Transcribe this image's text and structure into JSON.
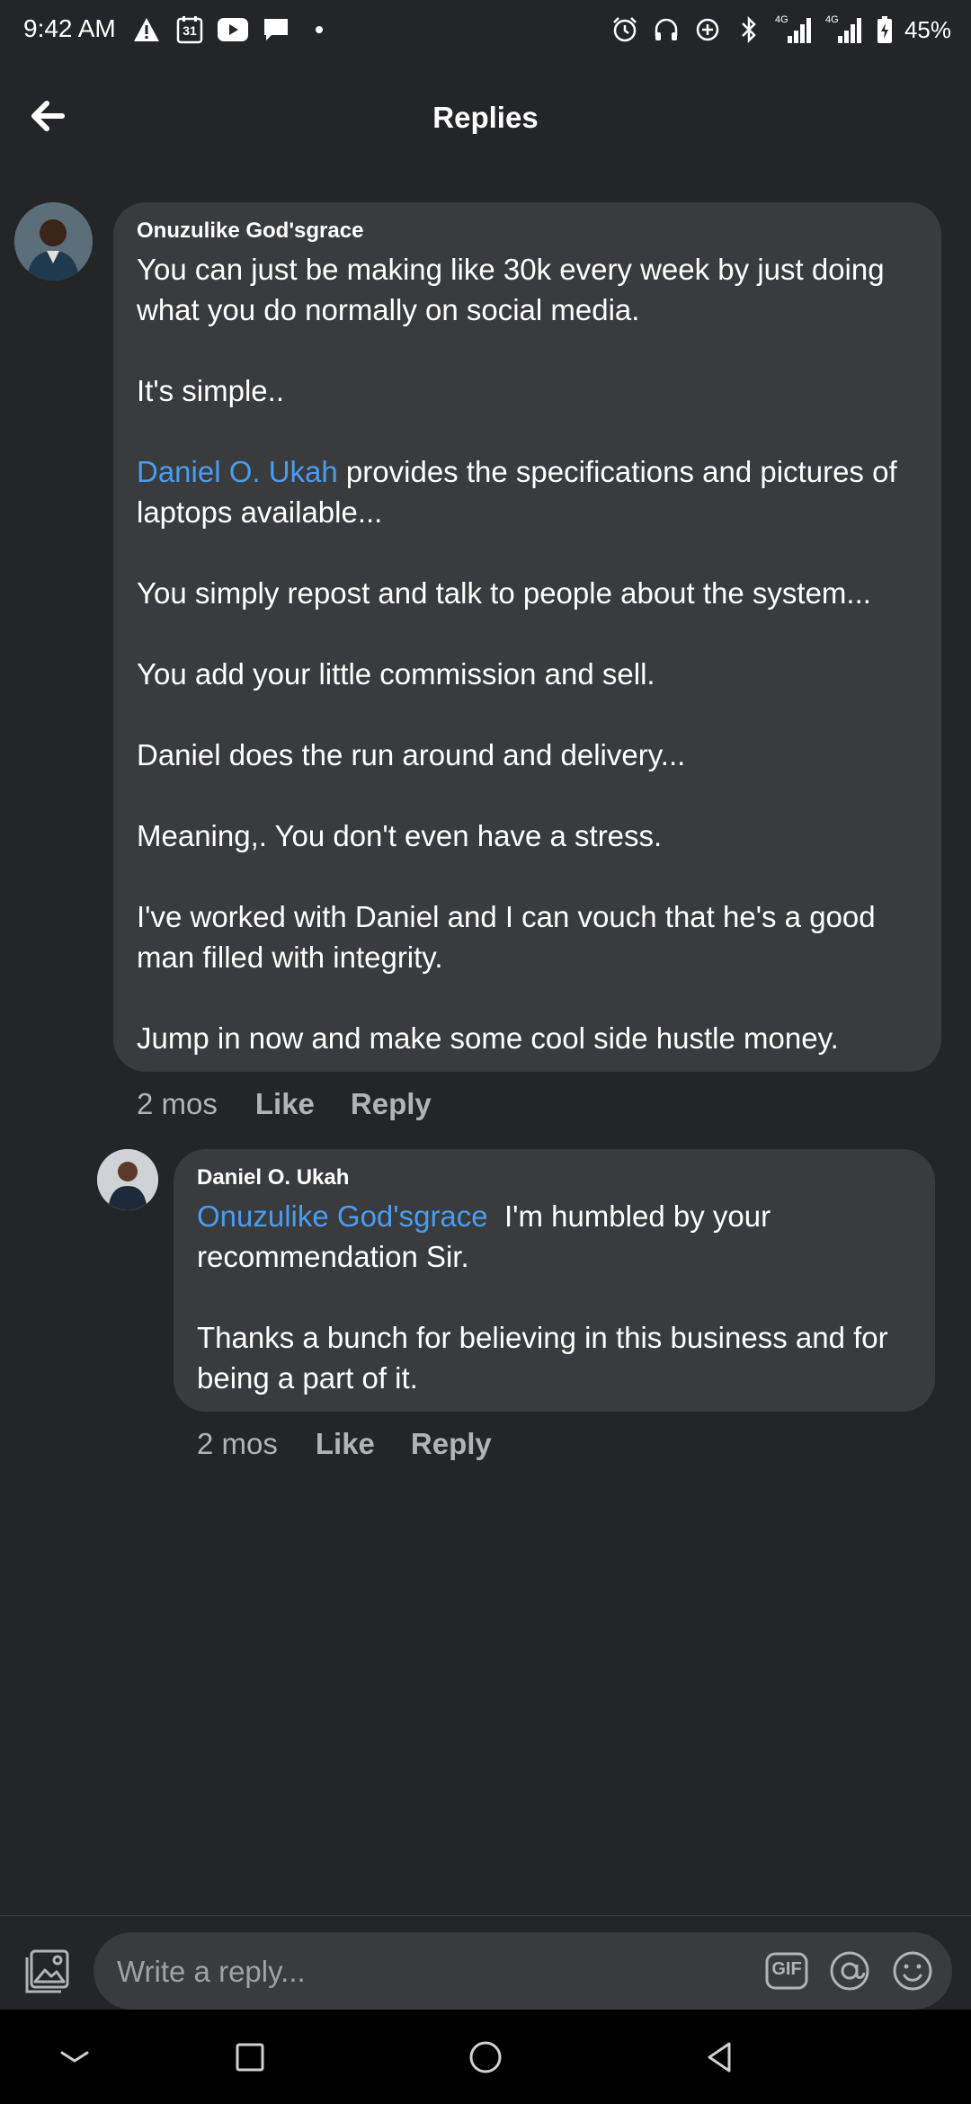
{
  "status_bar": {
    "time": "9:42 AM",
    "calendar_day": "31",
    "network_labels": [
      "4G",
      "4G"
    ],
    "battery": "45%",
    "left_icons": [
      "warning-icon",
      "calendar-icon",
      "youtube-icon",
      "message-icon",
      "dot-icon"
    ],
    "right_icons": [
      "alarm-icon",
      "headphones-icon",
      "data-saver-icon",
      "bluetooth-icon",
      "signal-icon",
      "signal-icon",
      "battery-icon"
    ]
  },
  "header": {
    "title": "Replies",
    "back_icon": "arrow-left-icon"
  },
  "comments": [
    {
      "author": "Onuzulike God'sgrace",
      "paragraphs": [
        {
          "text": "You can just be making like 30k every week by just doing what you do normally on social media."
        },
        {
          "text": "It's simple.."
        },
        {
          "mention": "Daniel O. Ukah",
          "text": " provides the specifications and pictures of laptops available..."
        },
        {
          "text": "You simply repost and talk to people about the system..."
        },
        {
          "text": "You add your little commission and sell."
        },
        {
          "text": "Daniel does the run around and delivery..."
        },
        {
          "text": "Meaning,. You don't even have a stress."
        },
        {
          "text": "I've worked with Daniel and I can vouch that he's a good man filled with integrity."
        },
        {
          "text": "Jump in now and make some cool side hustle money."
        }
      ],
      "time": "2 mos",
      "like_label": "Like",
      "reply_label": "Reply"
    },
    {
      "author": "Daniel O. Ukah",
      "paragraphs": [
        {
          "mention": "Onuzulike God'sgrace",
          "text": "  I'm humbled by your recommendation Sir."
        },
        {
          "text": "Thanks a bunch for believing in this business and for being a part of it."
        }
      ],
      "time": "2 mos",
      "like_label": "Like",
      "reply_label": "Reply"
    }
  ],
  "composer": {
    "placeholder": "Write a reply...",
    "gif_label": "GIF",
    "icons": [
      "photo-icon",
      "gif-icon",
      "mention-icon",
      "emoji-icon"
    ]
  },
  "nav_bar": {
    "icons": [
      "chevron-down-icon",
      "recents-icon",
      "home-icon",
      "back-triangle-icon"
    ]
  },
  "colors": {
    "background": "#242526",
    "bubble": "#3a3b3c",
    "mention": "#4a9cf0",
    "meta_text": "#b0b3b8"
  }
}
